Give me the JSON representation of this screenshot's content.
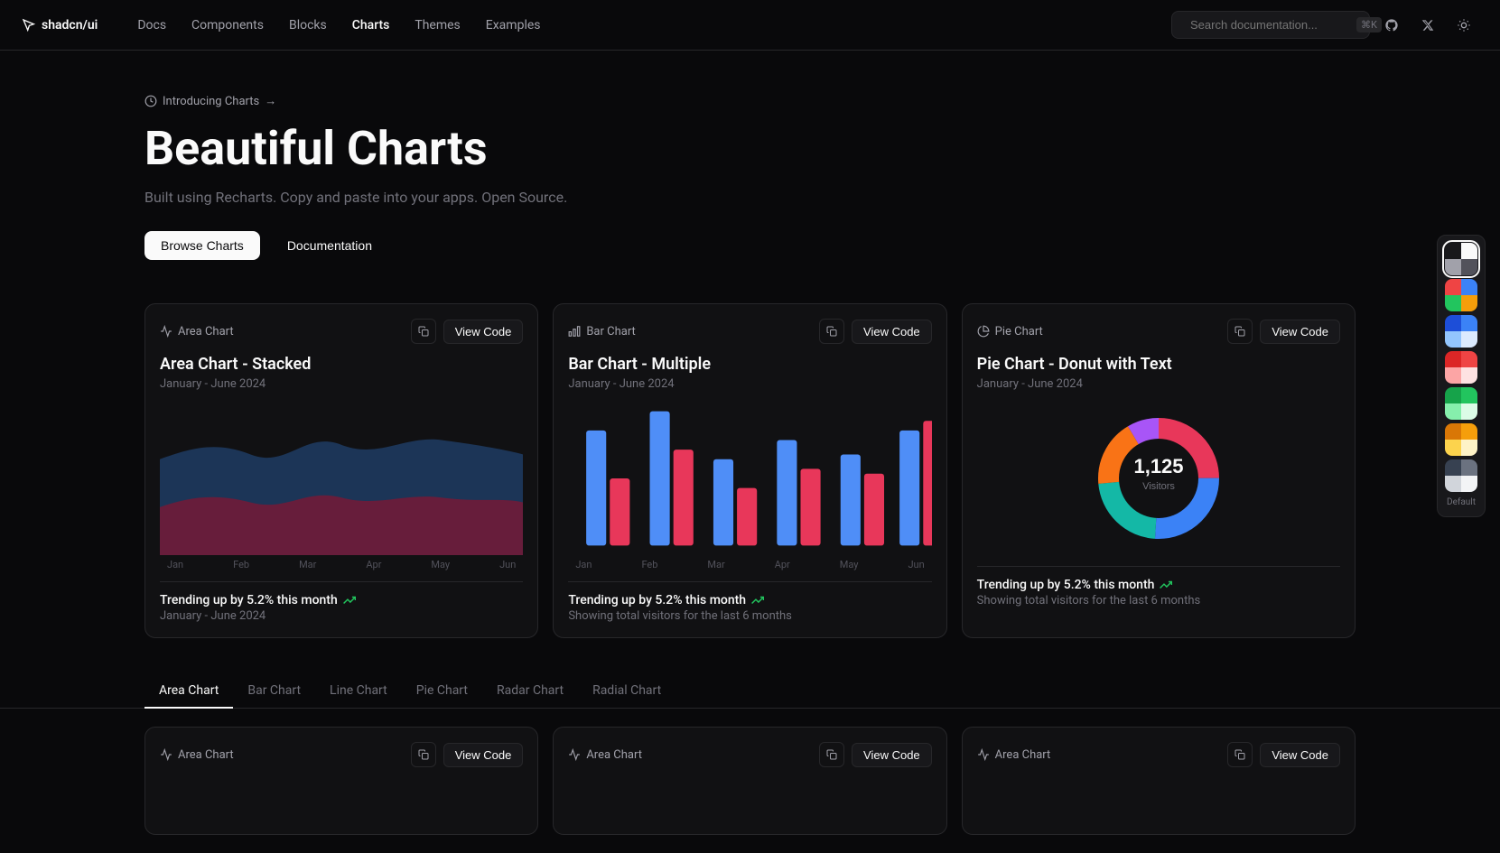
{
  "nav": {
    "logo": "shadcn/ui",
    "links": [
      "Docs",
      "Components",
      "Blocks",
      "Charts",
      "Themes",
      "Examples"
    ],
    "active_link": "Charts",
    "search_placeholder": "Search documentation...",
    "search_kbd": "⌘K"
  },
  "hero": {
    "badge_text": "Introducing Charts",
    "badge_arrow": "→",
    "title": "Beautiful Charts",
    "subtitle": "Built using Recharts. Copy and paste into your apps. Open Source.",
    "btn_browse": "Browse Charts",
    "btn_docs": "Documentation"
  },
  "showcase_cards": [
    {
      "label": "Area Chart",
      "title": "Area Chart - Stacked",
      "period": "January - June 2024",
      "trend": "Trending up by 5.2% this month",
      "range": "January - June 2024",
      "view_code": "View Code"
    },
    {
      "label": "Bar Chart",
      "title": "Bar Chart - Multiple",
      "period": "January - June 2024",
      "trend": "Trending up by 5.2% this month",
      "range": "Showing total visitors for the last 6 months",
      "view_code": "View Code"
    },
    {
      "label": "Pie Chart",
      "title": "Pie Chart - Donut with Text",
      "period": "January - June 2024",
      "trend": "Trending up by 5.2% this month",
      "range": "Showing total visitors for the last 6 months",
      "view_code": "View Code"
    }
  ],
  "x_labels": [
    "Jan",
    "Feb",
    "Mar",
    "Apr",
    "May",
    "Jun"
  ],
  "donut": {
    "value": "1,125",
    "label": "Visitors"
  },
  "category_tabs": [
    "Area Chart",
    "Bar Chart",
    "Line Chart",
    "Pie Chart",
    "Radar Chart",
    "Radial Chart"
  ],
  "active_cat": "Area Chart",
  "bottom_cards": [
    {
      "label": "Area Chart",
      "view_code": "View Code",
      "sub": "Area Chart"
    },
    {
      "label": "Area Chart",
      "view_code": "View Code",
      "sub": "Area Chart"
    },
    {
      "label": "Area Chart",
      "view_code": "View Code",
      "sub": "Area Chart"
    }
  ],
  "theme_swatches": [
    {
      "id": "default",
      "colors": [
        "#18181b",
        "#fafafa",
        "#a1a1aa",
        "#52525b"
      ],
      "active": true
    },
    {
      "id": "colorful",
      "colors": [
        "#ef4444",
        "#3b82f6",
        "#22c55e",
        "#f59e0b"
      ],
      "active": false
    },
    {
      "id": "blue",
      "colors": [
        "#1d4ed8",
        "#3b82f6",
        "#93c5fd",
        "#dbeafe"
      ],
      "active": false
    },
    {
      "id": "red",
      "colors": [
        "#dc2626",
        "#ef4444",
        "#fca5a5",
        "#fee2e2"
      ],
      "active": false
    },
    {
      "id": "green",
      "colors": [
        "#16a34a",
        "#22c55e",
        "#86efac",
        "#dcfce7"
      ],
      "active": false
    },
    {
      "id": "orange",
      "colors": [
        "#d97706",
        "#f59e0b",
        "#fcd34d",
        "#fef3c7"
      ],
      "active": false
    },
    {
      "id": "gray",
      "colors": [
        "#374151",
        "#6b7280",
        "#d1d5db",
        "#f3f4f6"
      ],
      "active": false
    }
  ]
}
